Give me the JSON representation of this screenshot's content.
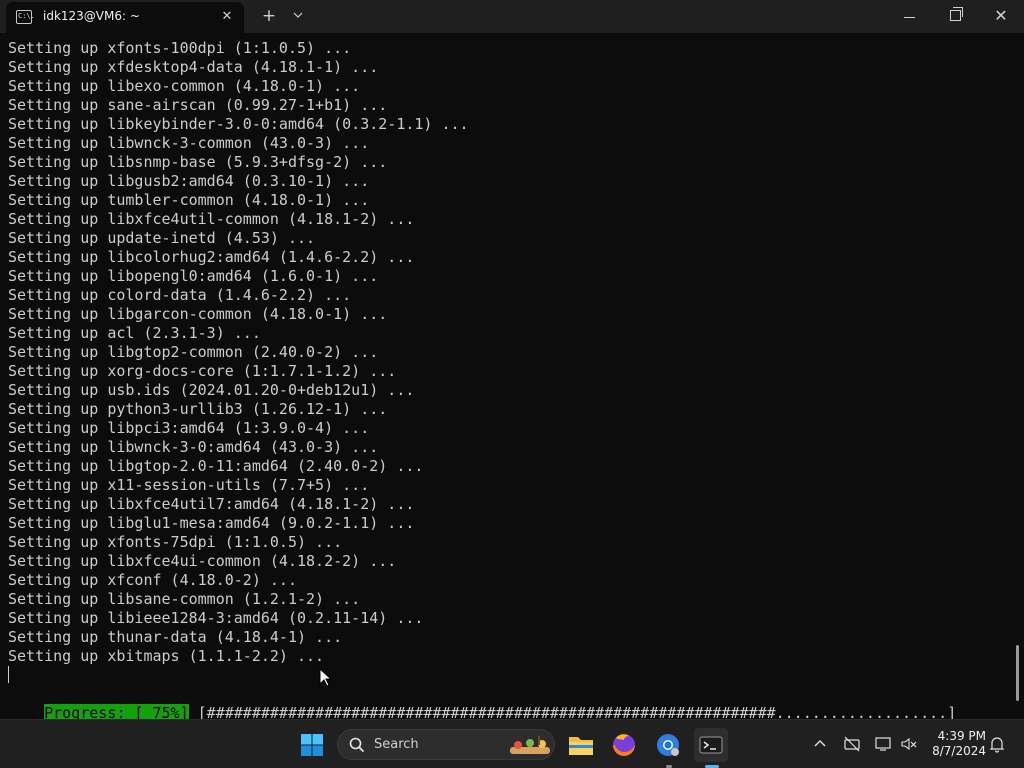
{
  "window": {
    "tab_title": "idk123@VM6: ~",
    "tab_icon_text": "C:\\.",
    "close_tab_symbol": "✕",
    "new_tab_symbol": "+",
    "dropdown_symbol": "⌄",
    "minimize_symbol": "—",
    "close_symbol": "✕"
  },
  "terminal": {
    "lines": [
      "Setting up xfonts-100dpi (1:1.0.5) ...",
      "Setting up xfdesktop4-data (4.18.1-1) ...",
      "Setting up libexo-common (4.18.0-1) ...",
      "Setting up sane-airscan (0.99.27-1+b1) ...",
      "Setting up libkeybinder-3.0-0:amd64 (0.3.2-1.1) ...",
      "Setting up libwnck-3-common (43.0-3) ...",
      "Setting up libsnmp-base (5.9.3+dfsg-2) ...",
      "Setting up libgusb2:amd64 (0.3.10-1) ...",
      "Setting up tumbler-common (4.18.0-1) ...",
      "Setting up libxfce4util-common (4.18.1-2) ...",
      "Setting up update-inetd (4.53) ...",
      "Setting up libcolorhug2:amd64 (1.4.6-2.2) ...",
      "Setting up libopengl0:amd64 (1.6.0-1) ...",
      "Setting up colord-data (1.4.6-2.2) ...",
      "Setting up libgarcon-common (4.18.0-1) ...",
      "Setting up acl (2.3.1-3) ...",
      "Setting up libgtop2-common (2.40.0-2) ...",
      "Setting up xorg-docs-core (1:1.7.1-1.2) ...",
      "Setting up usb.ids (2024.01.20-0+deb12u1) ...",
      "Setting up python3-urllib3 (1.26.12-1) ...",
      "Setting up libpci3:amd64 (1:3.9.0-4) ...",
      "Setting up libwnck-3-0:amd64 (43.0-3) ...",
      "Setting up libgtop-2.0-11:amd64 (2.40.0-2) ...",
      "Setting up x11-session-utils (7.7+5) ...",
      "Setting up libxfce4util7:amd64 (4.18.1-2) ...",
      "Setting up libglu1-mesa:amd64 (9.0.2-1.1) ...",
      "Setting up xfonts-75dpi (1:1.0.5) ...",
      "Setting up libxfce4ui-common (4.18.2-2) ...",
      "Setting up xfconf (4.18.0-2) ...",
      "Setting up libsane-common (1.2.1-2) ...",
      "Setting up libieee1284-3:amd64 (0.2.11-14) ...",
      "Setting up thunar-data (4.18.4-1) ...",
      "Setting up xbitmaps (1.1.1-2.2) ..."
    ],
    "progress_label": "Progress: [ 75%]",
    "progress_bar": " [###############################################################...................]",
    "progress_percent": 75
  },
  "taskbar": {
    "search_placeholder": "Search",
    "clock_time": "4:39 PM",
    "clock_date": "8/7/2024",
    "tray_chevron": "^",
    "icons": [
      "start-icon",
      "search-icon",
      "file-explorer-icon",
      "firefox-icon",
      "chrome-icon",
      "terminal-icon",
      "network-off-icon",
      "display-icon",
      "volume-muted-icon",
      "notification-bell-icon"
    ]
  },
  "colors": {
    "terminal_bg": "#0c0c0c",
    "terminal_fg": "#cccccc",
    "progress_green": "#13a10e",
    "taskbar_bg": "#202020",
    "accent": "#5fb2f2"
  }
}
